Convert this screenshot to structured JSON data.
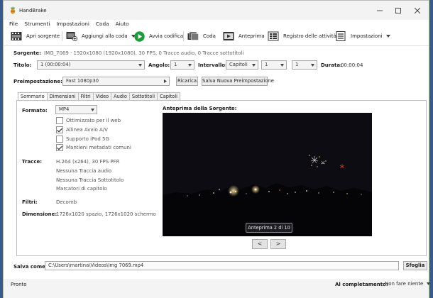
{
  "window": {
    "title": "HandBrake"
  },
  "menu": [
    "File",
    "Strumenti",
    "Impostazioni",
    "Coda",
    "Aiuto"
  ],
  "toolbar": {
    "open_source": "Apri sorgente",
    "add_to_queue": "Aggiungi alla coda",
    "start_encode": "Avvia codifica",
    "queue": "Coda",
    "preview": "Anteprima",
    "activity_log": "Registro delle attività",
    "presets": "Impostazioni"
  },
  "source": {
    "label": "Sorgente:",
    "value": "IMG_7069 · 1920x1080 (1920x1080), 30 FPS, 0 Tracce audio, 0 Tracce sottotitoli"
  },
  "title_row": {
    "title_label": "Titolo:",
    "title_value": "1 (00:00:04)",
    "angle_label": "Angolo:",
    "angle_value": "1",
    "range_label": "Intervallo:",
    "range_mode": "Capitoli",
    "range_start": "1",
    "range_end": "1",
    "duration_label": "Durata:",
    "duration_value": "00:00:04"
  },
  "preset": {
    "label": "Preimpostazione:",
    "value": "Fast 1080p30",
    "reload": "Ricarica",
    "save_new": "Salva Nuova Preimpostazione"
  },
  "tabs": [
    "Sommario",
    "Dimensioni",
    "Filtri",
    "Video",
    "Audio",
    "Sottotitoli",
    "Capitoli"
  ],
  "summary": {
    "format_label": "Formato:",
    "format_value": "MP4",
    "options": [
      {
        "label": "Ottimizzato per il web",
        "checked": false
      },
      {
        "label": "Allinea Avvio A/V",
        "checked": true
      },
      {
        "label": "Supporto iPod 5G",
        "checked": false
      },
      {
        "label": "Mantieni metadati comuni",
        "checked": true
      }
    ],
    "tracks_label": "Tracce:",
    "tracks": [
      "H.264 (x264), 30 FPS PFR",
      "Nessuna Traccia audio",
      "Nessuna Traccia Sottotitolo",
      "Marcatori di capitolo"
    ],
    "filters_label": "Filtri:",
    "filters_value": "Decomb",
    "dimensions_label": "Dimensione:",
    "dimensions_value": "1726x1020 spazio, 1726x1020 schermo",
    "preview_label": "Anteprima della Sorgente:",
    "preview_badge": "Anteprima 2 di 10",
    "prev": "<",
    "next": ">"
  },
  "save_as": {
    "label": "Salva come:",
    "value": "C:\\Users\\martina\\Videos\\Img 7069.mp4",
    "browse": "Sfoglia"
  },
  "status": {
    "text": "Pronto",
    "when_done_label": "Al completamento:",
    "when_done_value": "Non fare niente"
  },
  "colors": {
    "start_green": "#1f9b3c",
    "accent": "#2a6ed6"
  }
}
